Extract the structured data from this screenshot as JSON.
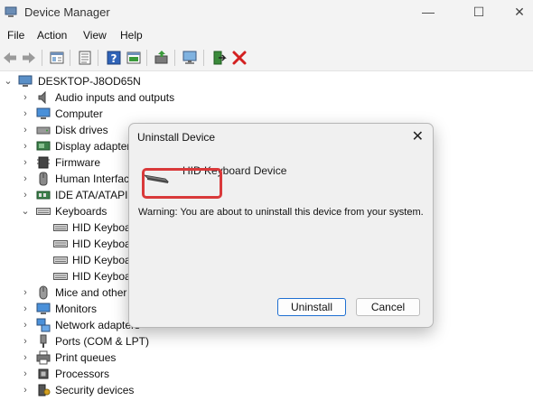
{
  "window": {
    "title": "Device Manager",
    "controls": {
      "minimize": "—",
      "maximize": "☐",
      "close": "✕"
    }
  },
  "menu": [
    "File",
    "Action",
    "View",
    "Help"
  ],
  "toolbar": {
    "icons": [
      "back-icon",
      "forward-icon",
      "properties-icon",
      "device-list-icon",
      "help-icon",
      "show-hidden-icon",
      "update-driver-icon",
      "scan-hardware-icon",
      "enable-device-icon",
      "uninstall-icon"
    ]
  },
  "tree": {
    "root": "DESKTOP-J8OD65N",
    "categories": [
      {
        "label": "Audio inputs and outputs",
        "icon": "speaker-icon",
        "expanded": false
      },
      {
        "label": "Computer",
        "icon": "computer-icon",
        "expanded": false
      },
      {
        "label": "Disk drives",
        "icon": "disk-drive-icon",
        "expanded": false
      },
      {
        "label": "Display adapter",
        "icon": "display-adapter-icon",
        "expanded": false
      },
      {
        "label": "Firmware",
        "icon": "firmware-icon",
        "expanded": false
      },
      {
        "label": "Human Interfac",
        "icon": "hid-icon",
        "expanded": false
      },
      {
        "label": "IDE ATA/ATAPI c",
        "icon": "ide-icon",
        "expanded": false
      },
      {
        "label": "Keyboards",
        "icon": "keyboard-icon",
        "expanded": true,
        "children": [
          "HID Keyboa",
          "HID Keyboa",
          "HID Keyboa",
          "HID Keyboa"
        ]
      },
      {
        "label": "Mice and other",
        "icon": "mouse-icon",
        "expanded": false
      },
      {
        "label": "Monitors",
        "icon": "monitor-icon",
        "expanded": false
      },
      {
        "label": "Network adapters",
        "icon": "network-icon",
        "expanded": false
      },
      {
        "label": "Ports (COM & LPT)",
        "icon": "port-icon",
        "expanded": false
      },
      {
        "label": "Print queues",
        "icon": "printer-icon",
        "expanded": false
      },
      {
        "label": "Processors",
        "icon": "processor-icon",
        "expanded": false
      },
      {
        "label": "Security devices",
        "icon": "security-icon",
        "expanded": false
      }
    ]
  },
  "dialog": {
    "title": "Uninstall Device",
    "close": "✕",
    "device_name": "HID Keyboard Device",
    "warning": "Warning: You are about to uninstall this device from your system.",
    "uninstall_label": "Uninstall",
    "cancel_label": "Cancel",
    "highlight_color": "#d9393a"
  }
}
